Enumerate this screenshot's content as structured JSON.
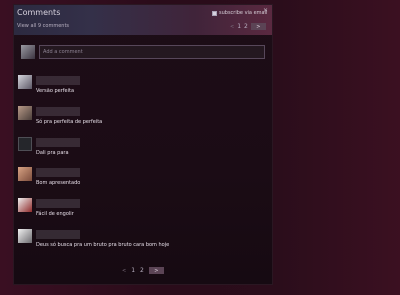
{
  "panel": {
    "title": "Comments",
    "view_all": "View all 9 comments",
    "subscribe_label": "subscribe via email",
    "close": "×",
    "pager_top": {
      "prev": "<",
      "current": "1",
      "next_page": "2",
      "next": ">"
    }
  },
  "compose": {
    "placeholder": "Add a comment"
  },
  "comments": [
    {
      "author": "",
      "text": "Versão perfeita"
    },
    {
      "author": "",
      "text": "Só pra perfeita de perfeita"
    },
    {
      "author": "",
      "text": "Dali pra para"
    },
    {
      "author": "",
      "text": "Bom apresentado"
    },
    {
      "author": "",
      "text": "Fácil de engolir"
    },
    {
      "author": "",
      "text": "Deus só busca pra um bruto pra bruto cara bom hoje"
    }
  ],
  "pager_bottom": {
    "prev": "<",
    "page1": "1",
    "page2": "2",
    "next": ">"
  }
}
